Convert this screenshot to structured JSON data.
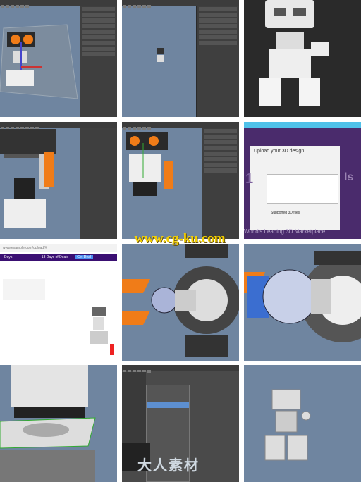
{
  "overlay": {
    "watermark": "www.cg-ku.com",
    "logo": "大人素材"
  },
  "tile_web": {
    "url": "www.example.com/upload/#",
    "banner_left": "Days",
    "banner_mid": "13 Days of Deals",
    "banner_right": "Get Deal"
  },
  "tile_upload": {
    "title": "Upload your 3D design",
    "supported": "Supported 3D files",
    "bg_text": "World's Leading 3D Marketplace",
    "bg_side": "1",
    "bg_side2": "ls"
  },
  "colors": {
    "viewport": "#6f85a0",
    "maya_panel": "#3f3f3f",
    "accent_orange": "#f28c28",
    "watermark": "#f4d000"
  }
}
